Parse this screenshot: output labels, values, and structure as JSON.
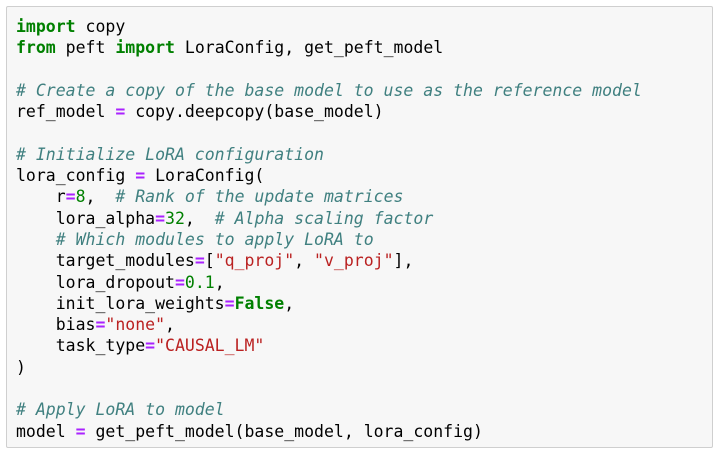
{
  "code_lines": [
    [
      {
        "t": "kw",
        "v": "import"
      },
      {
        "t": "n",
        "v": " copy"
      }
    ],
    [
      {
        "t": "kw",
        "v": "from"
      },
      {
        "t": "n",
        "v": " peft "
      },
      {
        "t": "kw",
        "v": "import"
      },
      {
        "t": "n",
        "v": " LoraConfig, get_peft_model"
      }
    ],
    [],
    [
      {
        "t": "cm",
        "v": "# Create a copy of the base model to use as the reference model"
      }
    ],
    [
      {
        "t": "n",
        "v": "ref_model "
      },
      {
        "t": "op",
        "v": "="
      },
      {
        "t": "n",
        "v": " copy.deepcopy(base_model)"
      }
    ],
    [],
    [
      {
        "t": "cm",
        "v": "# Initialize LoRA configuration"
      }
    ],
    [
      {
        "t": "n",
        "v": "lora_config "
      },
      {
        "t": "op",
        "v": "="
      },
      {
        "t": "n",
        "v": " LoraConfig("
      }
    ],
    [
      {
        "t": "n",
        "v": "    r"
      },
      {
        "t": "op",
        "v": "="
      },
      {
        "t": "num",
        "v": "8"
      },
      {
        "t": "n",
        "v": ",  "
      },
      {
        "t": "cm",
        "v": "# Rank of the update matrices"
      }
    ],
    [
      {
        "t": "n",
        "v": "    lora_alpha"
      },
      {
        "t": "op",
        "v": "="
      },
      {
        "t": "num",
        "v": "32"
      },
      {
        "t": "n",
        "v": ",  "
      },
      {
        "t": "cm",
        "v": "# Alpha scaling factor"
      }
    ],
    [
      {
        "t": "n",
        "v": "    "
      },
      {
        "t": "cm",
        "v": "# Which modules to apply LoRA to"
      }
    ],
    [
      {
        "t": "n",
        "v": "    target_modules"
      },
      {
        "t": "op",
        "v": "="
      },
      {
        "t": "n",
        "v": "["
      },
      {
        "t": "str",
        "v": "\"q_proj\""
      },
      {
        "t": "n",
        "v": ", "
      },
      {
        "t": "str",
        "v": "\"v_proj\""
      },
      {
        "t": "n",
        "v": "],"
      }
    ],
    [
      {
        "t": "n",
        "v": "    lora_dropout"
      },
      {
        "t": "op",
        "v": "="
      },
      {
        "t": "num",
        "v": "0.1"
      },
      {
        "t": "n",
        "v": ","
      }
    ],
    [
      {
        "t": "n",
        "v": "    init_lora_weights"
      },
      {
        "t": "op",
        "v": "="
      },
      {
        "t": "kw",
        "v": "False"
      },
      {
        "t": "n",
        "v": ","
      }
    ],
    [
      {
        "t": "n",
        "v": "    bias"
      },
      {
        "t": "op",
        "v": "="
      },
      {
        "t": "str",
        "v": "\"none\""
      },
      {
        "t": "n",
        "v": ","
      }
    ],
    [
      {
        "t": "n",
        "v": "    task_type"
      },
      {
        "t": "op",
        "v": "="
      },
      {
        "t": "str",
        "v": "\"CAUSAL_LM\""
      }
    ],
    [
      {
        "t": "n",
        "v": ")"
      }
    ],
    [],
    [
      {
        "t": "cm",
        "v": "# Apply LoRA to model"
      }
    ],
    [
      {
        "t": "n",
        "v": "model "
      },
      {
        "t": "op",
        "v": "="
      },
      {
        "t": "n",
        "v": " get_peft_model(base_model, lora_config)"
      }
    ]
  ]
}
